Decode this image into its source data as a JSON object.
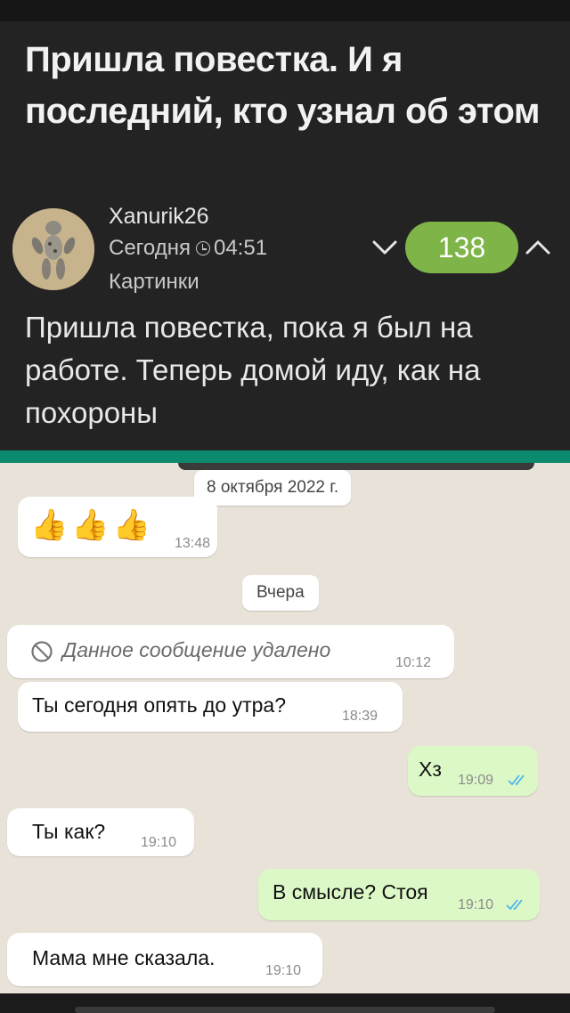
{
  "post": {
    "title": "Пришла повестка. И я последний, кто узнал об этом",
    "author": "Xanurik26",
    "date_label": "Сегодня",
    "time": "04:51",
    "category": "Картинки",
    "rating": "138",
    "text": "Пришла повестка, пока я был на работе. Теперь домой иду, как на похороны"
  },
  "chat": {
    "date1": "8 октября 2022 г.",
    "emoji_msg": {
      "emojis": [
        "👍",
        "👍",
        "👍"
      ],
      "time": "13:48"
    },
    "date2": "Вчера",
    "messages": [
      {
        "dir": "in",
        "text": "Данное сообщение удалено",
        "time": "10:12",
        "deleted": true
      },
      {
        "dir": "in",
        "text": "Ты сегодня опять до утра?",
        "time": "18:39"
      },
      {
        "dir": "out",
        "text": "Хз",
        "time": "19:09"
      },
      {
        "dir": "in",
        "text": "Ты как?",
        "time": "19:10"
      },
      {
        "dir": "out",
        "text": "В смысле? Стоя",
        "time": "19:10"
      },
      {
        "dir": "in",
        "text": "Мама мне сказала.",
        "time": "19:10"
      }
    ]
  },
  "colors": {
    "rating_bg": "#7fb448",
    "chat_header": "#0b8a6e",
    "outgoing_bubble": "#dcf8c6",
    "read_ticks": "#4fb6ec"
  },
  "icons": {
    "vote_down": "chevron-down-icon",
    "vote_up": "chevron-up-icon",
    "clock": "clock-icon",
    "deleted": "no-entry-icon",
    "read_ticks": "double-check-icon"
  }
}
